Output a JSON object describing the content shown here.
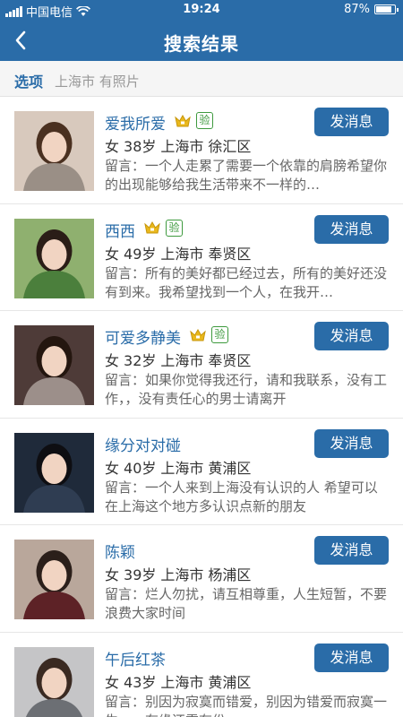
{
  "status": {
    "carrier": "中国电信",
    "time": "19:24",
    "battery": "87%",
    "battery_level": 0.87
  },
  "nav": {
    "title": "搜索结果"
  },
  "filter": {
    "label": "选项",
    "value": "上海市 有照片"
  },
  "send_label": "发消息",
  "verify_label": "验",
  "users": [
    {
      "name": "爱我所爱",
      "gender": "女",
      "age": "38岁",
      "city": "上海市",
      "district": "徐汇区",
      "message": "留言：一个人走累了需要一个依靠的肩膀希望你的出现能够给我生活带来不一样的…",
      "vip": true,
      "verified": true
    },
    {
      "name": "西西",
      "gender": "女",
      "age": "49岁",
      "city": "上海市",
      "district": "奉贤区",
      "message": "留言：所有的美好都已经过去，所有的美好还没有到来。我希望找到一个人，在我开…",
      "vip": true,
      "verified": true
    },
    {
      "name": "可爱多静美",
      "gender": "女",
      "age": "32岁",
      "city": "上海市",
      "district": "奉贤区",
      "message": "留言：如果你觉得我还行，请和我联系，没有工作，，没有责任心的男士请离开",
      "vip": true,
      "verified": true
    },
    {
      "name": "缘分对对碰",
      "gender": "女",
      "age": "40岁",
      "city": "上海市",
      "district": "黄浦区",
      "message": "留言：一个人来到上海没有认识的人 希望可以在上海这个地方多认识点新的朋友",
      "vip": false,
      "verified": false
    },
    {
      "name": "陈颖",
      "gender": "女",
      "age": "39岁",
      "city": "上海市",
      "district": "杨浦区",
      "message": "留言：烂人勿扰，请互相尊重，人生短暂，不要浪费大家时间",
      "vip": false,
      "verified": false
    },
    {
      "name": "午后红茶",
      "gender": "女",
      "age": "43岁",
      "city": "上海市",
      "district": "黄浦区",
      "message": "留言：别因为寂寞而错爱，别因为错爱而寂寞一生……有缘还需有份",
      "vip": false,
      "verified": false
    }
  ]
}
